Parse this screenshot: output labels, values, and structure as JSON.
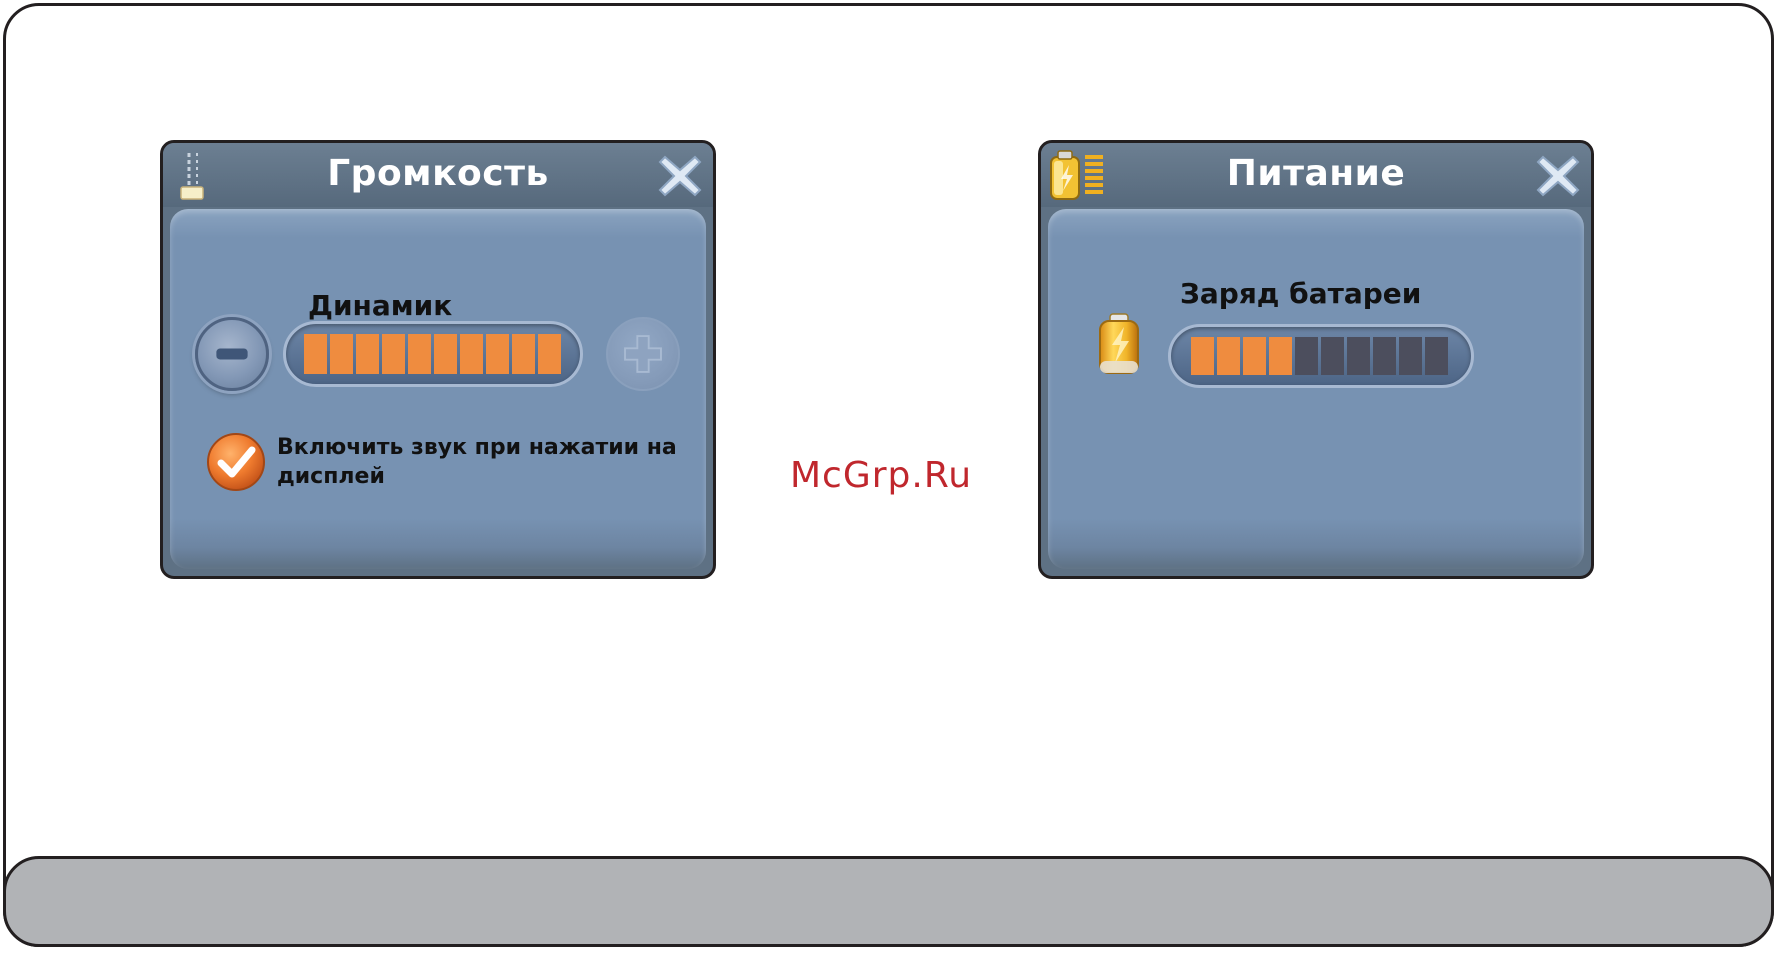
{
  "watermark": "McGrp.Ru",
  "volume_dialog": {
    "title": "Громкость",
    "title_icon": "volume-slider-icon",
    "close_icon": "close-x-icon",
    "speaker_label": "Динамик",
    "decrease_icon": "minus-icon",
    "increase_icon": "plus-icon",
    "speaker_level": {
      "filled": 10,
      "total": 10
    },
    "tap_sound": {
      "checked": true,
      "label_line1": "Включить звук при нажатии на",
      "label_line2": "дисплей"
    }
  },
  "power_dialog": {
    "title": "Питание",
    "title_icon": "battery-level-icon",
    "close_icon": "close-x-icon",
    "battery_label": "Заряд батареи",
    "battery_icon": "battery-icon",
    "battery_level": {
      "filled": 4,
      "total": 10
    }
  },
  "colors": {
    "dialog_title_bg": "#5e7184",
    "dialog_body_bg": "#7792b2",
    "level_fill": "#ef8c3f",
    "level_empty": "#4c4e5d",
    "footer_bar": "#b1b3b6",
    "watermark": "#c0272d"
  }
}
